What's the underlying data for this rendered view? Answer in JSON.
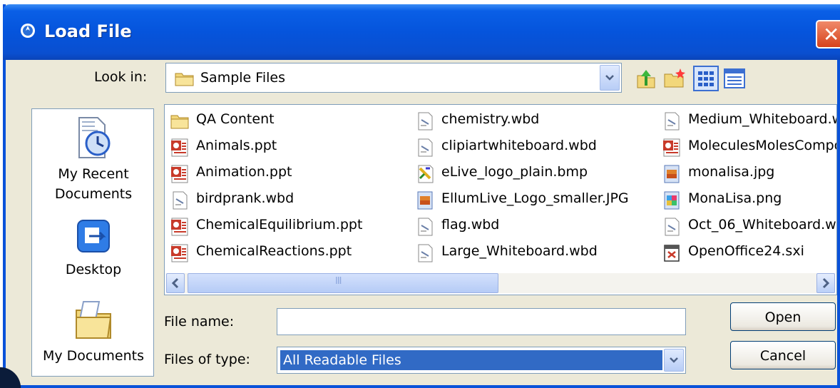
{
  "window": {
    "title": "Load File"
  },
  "look_in": {
    "label": "Look in:",
    "value": "Sample Files"
  },
  "places": [
    {
      "label": "My Recent\nDocuments",
      "line1": "My Recent",
      "line2": "Documents"
    },
    {
      "label": "Desktop"
    },
    {
      "label": "My Documents"
    }
  ],
  "files": {
    "col1": [
      {
        "name": "QA Content",
        "icon": "folder-icon"
      },
      {
        "name": "Animals.ppt",
        "icon": "ppt-icon"
      },
      {
        "name": "Animation.ppt",
        "icon": "ppt-icon"
      },
      {
        "name": "birdprank.wbd",
        "icon": "wbd-icon"
      },
      {
        "name": "ChemicalEquilibrium.ppt",
        "icon": "ppt-icon"
      },
      {
        "name": "ChemicalReactions.ppt",
        "icon": "ppt-icon"
      }
    ],
    "col2": [
      {
        "name": "chemistry.wbd",
        "icon": "wbd-icon"
      },
      {
        "name": "clipiartwhiteboard.wbd",
        "icon": "wbd-icon"
      },
      {
        "name": "eLive_logo_plain.bmp",
        "icon": "bmp-icon"
      },
      {
        "name": "EllumLive_Logo_smaller.JPG",
        "icon": "jpg-icon"
      },
      {
        "name": "flag.wbd",
        "icon": "wbd-icon"
      },
      {
        "name": "Large_Whiteboard.wbd",
        "icon": "wbd-icon"
      }
    ],
    "col3": [
      {
        "name": "Medium_Whiteboard.w",
        "icon": "wbd-icon"
      },
      {
        "name": "MoleculesMolesCompo",
        "icon": "ppt-icon"
      },
      {
        "name": "monalisa.jpg",
        "icon": "jpg-icon"
      },
      {
        "name": "MonaLisa.png",
        "icon": "png-icon"
      },
      {
        "name": "Oct_06_Whiteboard.w",
        "icon": "wbd-icon"
      },
      {
        "name": "OpenOffice24.sxi",
        "icon": "sxi-icon"
      }
    ]
  },
  "form": {
    "file_name_label": "File name:",
    "file_name_value": "",
    "files_of_type_label": "Files of type:",
    "files_of_type_value": "All Readable Files"
  },
  "buttons": {
    "open": "Open",
    "cancel": "Cancel"
  },
  "scrollbar": {
    "grip": "III"
  },
  "colors": {
    "titlebar": "#0554dc",
    "dialog_bg": "#ece9d8",
    "selection": "#316ac5",
    "close": "#d6421c"
  }
}
